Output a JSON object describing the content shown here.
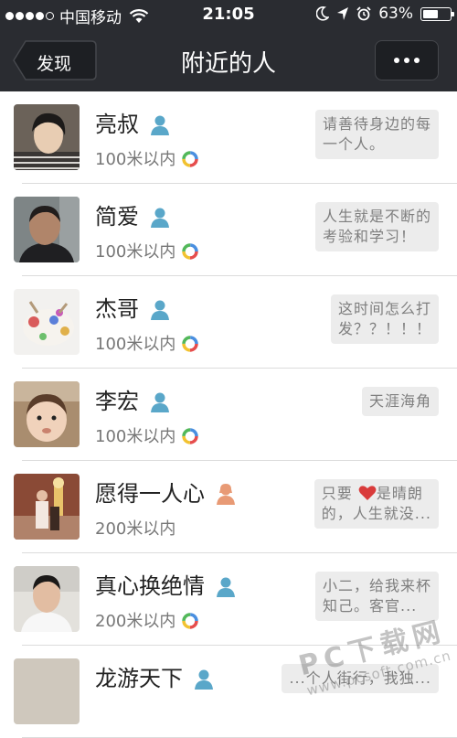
{
  "status_bar": {
    "carrier": "中国移动",
    "time": "21:05",
    "battery": "63%",
    "battery_level": 0.63,
    "signal_bars": 4,
    "icons": [
      "signal-dots-icon",
      "wifi-icon",
      "moon-icon",
      "location-arrow-icon",
      "alarm-icon",
      "battery-icon"
    ]
  },
  "nav": {
    "back_label": "发现",
    "title": "附近的人",
    "more_icon": "more-dots-icon"
  },
  "people": [
    {
      "name": "亮叔",
      "gender": "male",
      "distance": "100米以内",
      "has_moments": true,
      "signature": [
        "请善待身边的每",
        "一个人。"
      ]
    },
    {
      "name": "简爱",
      "gender": "male",
      "distance": "100米以内",
      "has_moments": true,
      "signature": [
        "人生就是不断的",
        "考验和学习！"
      ]
    },
    {
      "name": "杰哥",
      "gender": "male",
      "distance": "100米以内",
      "has_moments": true,
      "signature": [
        "这时间怎么打",
        "发？？！！！"
      ]
    },
    {
      "name": "李宏",
      "gender": "male",
      "distance": "100米以内",
      "has_moments": true,
      "signature": [
        "天涯海角"
      ]
    },
    {
      "name": "愿得一人心",
      "gender": "female",
      "distance": "200米以内",
      "has_moments": false,
      "signature": [
        "只要",
        "是晴朗",
        "的，人生就没..."
      ]
    },
    {
      "name": "真心换绝情",
      "gender": "male",
      "distance": "200米以内",
      "has_moments": true,
      "signature": [
        "小二，给我来杯",
        "知己。客官..."
      ]
    },
    {
      "name": "龙游天下",
      "gender": "male",
      "distance": "",
      "has_moments": false,
      "signature": [
        "...个人街行，我独..."
      ]
    }
  ],
  "watermark": {
    "main": "PC下载网",
    "url": "www.pcsoft.com.cn"
  },
  "colors": {
    "bar_bg": "#2a2c31",
    "male": "#5aa7c9",
    "female": "#e89a75",
    "bubble_bg": "#ececec"
  }
}
